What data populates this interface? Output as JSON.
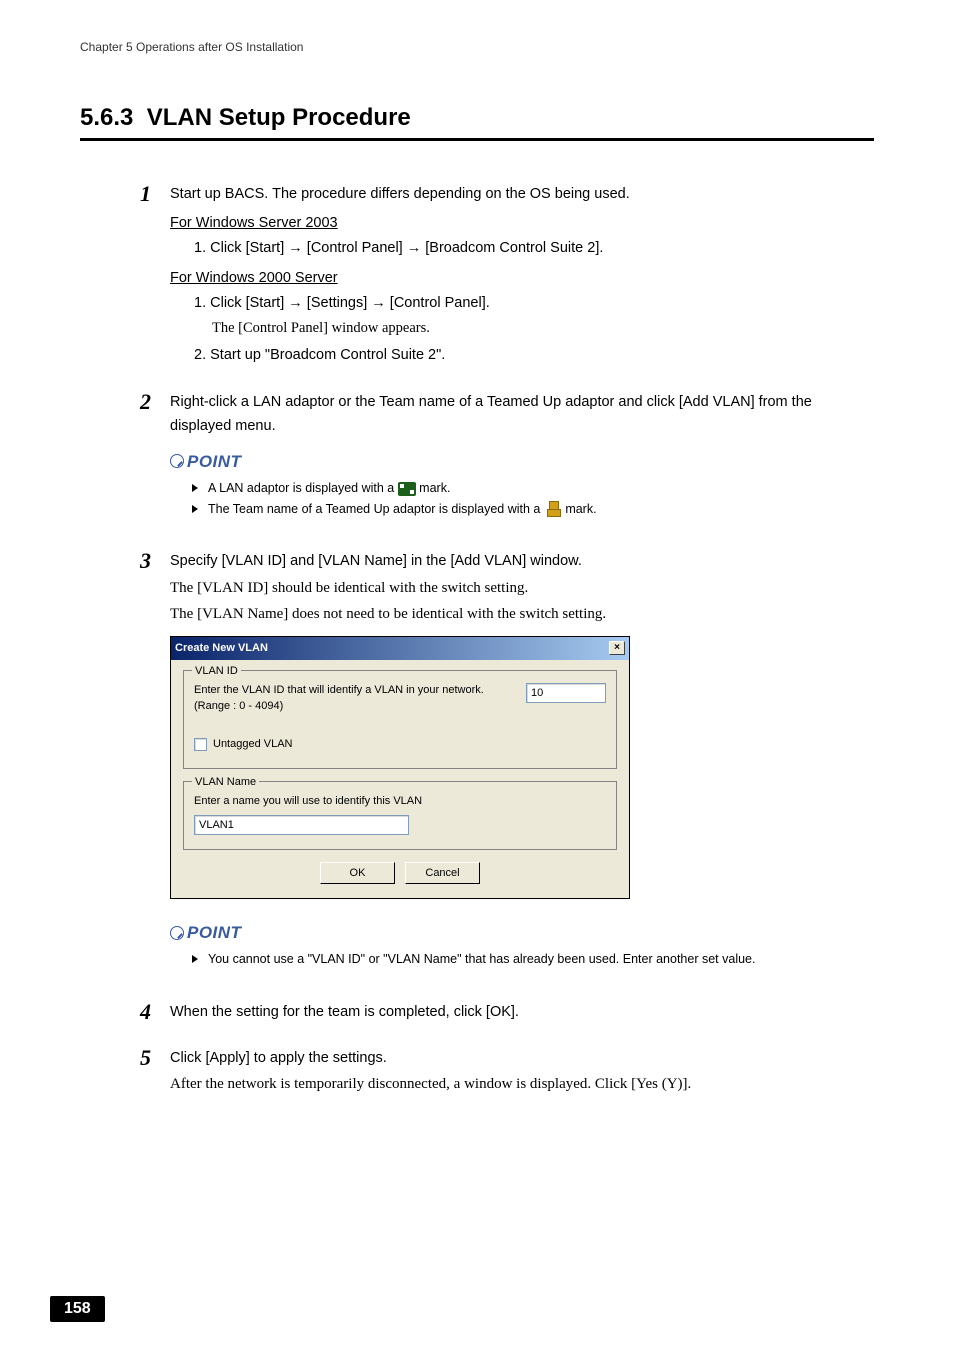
{
  "chapter": "Chapter 5  Operations after OS Installation",
  "section": {
    "number": "5.6.3",
    "title": "VLAN Setup Procedure"
  },
  "steps": {
    "s1": {
      "text": "Start up BACS. The procedure differs depending on the OS being used.",
      "win2003": {
        "heading": "For Windows Server 2003",
        "item1": "1.  Click [Start] → [Control Panel] → [Broadcom Control Suite 2]."
      },
      "win2000": {
        "heading": "For Windows 2000 Server",
        "item1": "1.  Click [Start] → [Settings] → [Control Panel].",
        "note1": "The [Control Panel] window appears.",
        "item2": "2.  Start up \"Broadcom Control Suite 2\"."
      }
    },
    "s2": {
      "text": "Right-click a LAN adaptor or the Team name of a Teamed Up adaptor and click [Add VLAN] from the displayed menu.",
      "point_label": "POINT",
      "p1a": "A LAN adaptor is displayed with a ",
      "p1b": "  mark.",
      "p2a": "The Team name of a Teamed Up adaptor is displayed with a ",
      "p2b": "  mark."
    },
    "s3": {
      "text": "Specify [VLAN ID] and [VLAN Name] in the [Add VLAN] window.",
      "note1": "The [VLAN ID] should be identical with the switch setting.",
      "note2": "The [VLAN Name] does not need to be identical with the switch setting.",
      "point_label": "POINT",
      "p1": "You cannot use a \"VLAN ID\" or \"VLAN Name\" that has already been used. Enter another set value."
    },
    "s4": {
      "text": "When the setting for the team is completed, click [OK]."
    },
    "s5": {
      "text": "Click [Apply] to apply the settings.",
      "note": "After the network is temporarily disconnected, a window is displayed. Click [Yes (Y)]."
    }
  },
  "dialog": {
    "title": "Create New VLAN",
    "vlan_id_group": "VLAN ID",
    "vlan_id_text": "Enter the VLAN ID that will identify a VLAN in your network. (Range : 0 - 4094)",
    "vlan_id_value": "10",
    "untagged": "Untagged VLAN",
    "vlan_name_group": "VLAN Name",
    "vlan_name_text": "Enter a name you will use to identify this VLAN",
    "vlan_name_value": "VLAN1",
    "ok": "OK",
    "cancel": "Cancel"
  },
  "page_number": "158"
}
